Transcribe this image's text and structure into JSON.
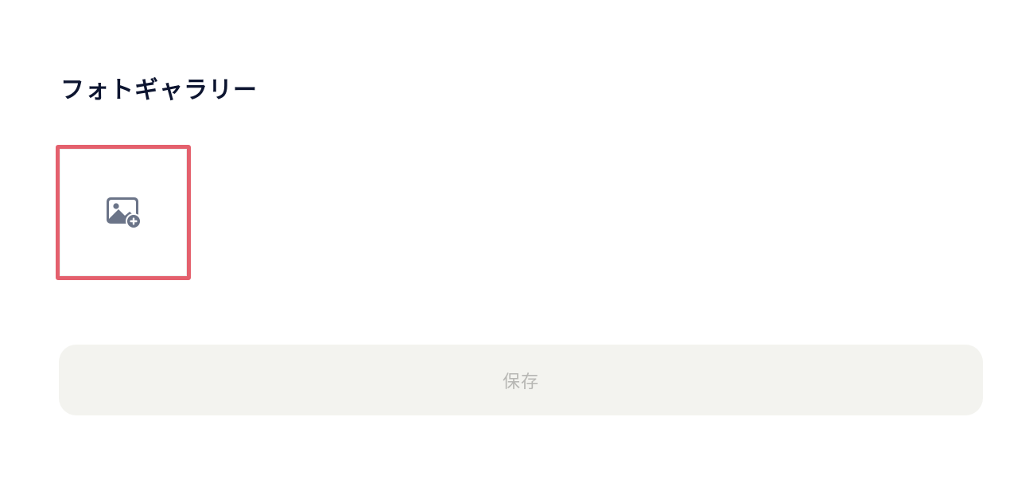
{
  "gallery": {
    "title": "フォトギャラリー",
    "add_photo_icon": "image-add-icon"
  },
  "colors": {
    "title": "#0d1530",
    "highlight_border": "#e4606d",
    "icon": "#6b7488",
    "button_bg": "#f3f3ef",
    "button_text": "#b7b7b4"
  },
  "actions": {
    "save_label": "保存"
  }
}
